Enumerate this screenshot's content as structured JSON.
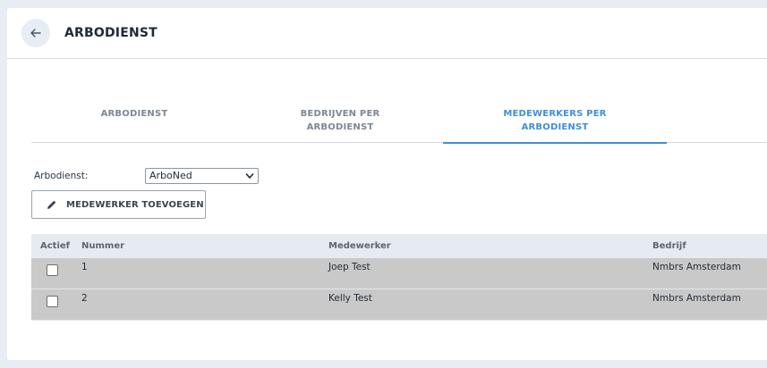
{
  "header": {
    "title": "ARBODIENST"
  },
  "tabs": [
    {
      "label": "ARBODIENST",
      "active": false
    },
    {
      "label": "BEDRIJVEN PER ARBODIENST",
      "active": false
    },
    {
      "label": "MEDEWERKERS PER ARBODIENST",
      "active": true
    }
  ],
  "filter": {
    "label": "Arbodienst:",
    "selected": "ArboNed"
  },
  "actions": {
    "add_label": "MEDEWERKER TOEVOEGEN"
  },
  "table": {
    "columns": [
      "Actief",
      "Nummer",
      "Medewerker",
      "Bedrijf"
    ],
    "rows": [
      {
        "nummer": "1",
        "medewerker": "Joep Test",
        "bedrijf": "Nmbrs Amsterdam"
      },
      {
        "nummer": "2",
        "medewerker": "Kelly Test",
        "bedrijf": "Nmbrs Amsterdam"
      }
    ]
  },
  "colors": {
    "accent": "#3f8fd7",
    "row_bg": "#c9c9c9",
    "header_bg": "#e6ebf1"
  },
  "icons": {
    "back": "arrow-left-icon",
    "add": "pencil-icon",
    "select": "chevron-down-icon"
  }
}
